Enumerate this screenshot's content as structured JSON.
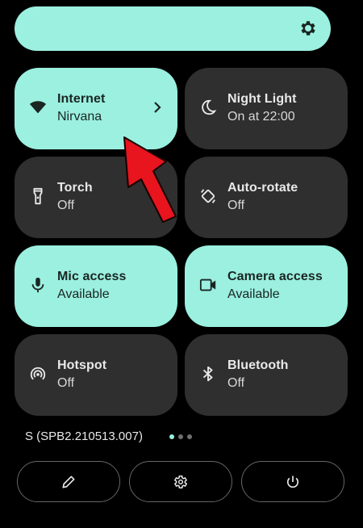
{
  "quick_settings": {
    "tiles": [
      {
        "id": "internet",
        "label": "Internet",
        "sublabel": "Nirvana",
        "state": "on",
        "icon": "wifi-icon",
        "has_chevron": true
      },
      {
        "id": "night-light",
        "label": "Night Light",
        "sublabel": "On at 22:00",
        "state": "off",
        "icon": "moon-icon"
      },
      {
        "id": "torch",
        "label": "Torch",
        "sublabel": "Off",
        "state": "off",
        "icon": "flashlight-icon"
      },
      {
        "id": "auto-rotate",
        "label": "Auto-rotate",
        "sublabel": "Off",
        "state": "off",
        "icon": "rotate-icon"
      },
      {
        "id": "mic-access",
        "label": "Mic access",
        "sublabel": "Available",
        "state": "on",
        "icon": "microphone-icon"
      },
      {
        "id": "camera-access",
        "label": "Camera access",
        "sublabel": "Available",
        "state": "on",
        "icon": "camera-icon"
      },
      {
        "id": "hotspot",
        "label": "Hotspot",
        "sublabel": "Off",
        "state": "off",
        "icon": "hotspot-icon"
      },
      {
        "id": "bluetooth",
        "label": "Bluetooth",
        "sublabel": "Off",
        "state": "off",
        "icon": "bluetooth-icon"
      }
    ]
  },
  "footer": {
    "build_number": "S (SPB2.210513.007)",
    "page_dots": {
      "count": 3,
      "active": 0
    }
  },
  "colors": {
    "accent": "#9bf0e0",
    "tile_off": "#2f2f2f",
    "background": "#000000",
    "arrow": "#e8141e"
  }
}
